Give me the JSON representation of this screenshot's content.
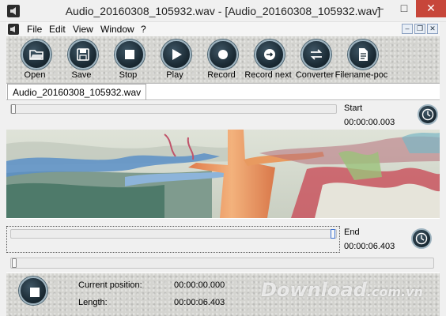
{
  "window": {
    "title": "Audio_20160308_105932.wav - [Audio_20160308_105932.wav]",
    "minimize": "–",
    "maximize": "□",
    "close": "✕"
  },
  "menu": {
    "items": [
      "File",
      "Edit",
      "View",
      "Window",
      "?"
    ],
    "mdi_minimize": "–",
    "mdi_restore": "❐",
    "mdi_close": "✕"
  },
  "toolbar": {
    "buttons": [
      {
        "label": "Open",
        "icon": "folder-icon"
      },
      {
        "label": "Save",
        "icon": "floppy-icon"
      },
      {
        "label": "Stop",
        "icon": "stop-icon"
      },
      {
        "label": "Play",
        "icon": "play-icon"
      },
      {
        "label": "Record",
        "icon": "record-icon"
      },
      {
        "label": "Record next",
        "icon": "record-next-icon"
      },
      {
        "label": "Converter",
        "icon": "converter-icon"
      },
      {
        "label": "Filename-poc",
        "icon": "document-icon"
      }
    ]
  },
  "document": {
    "tab": "Audio_20160308_105932.wav",
    "start": {
      "label": "Start",
      "time": "00:00:00.003"
    },
    "end": {
      "label": "End",
      "time": "00:00:06.403"
    }
  },
  "status": {
    "current_position_label": "Current position:",
    "current_position": "00:00:00.000",
    "length_label": "Length:",
    "length": "00:00:06.403"
  },
  "watermark": {
    "main": "Download",
    "suffix": ".com.vn"
  }
}
